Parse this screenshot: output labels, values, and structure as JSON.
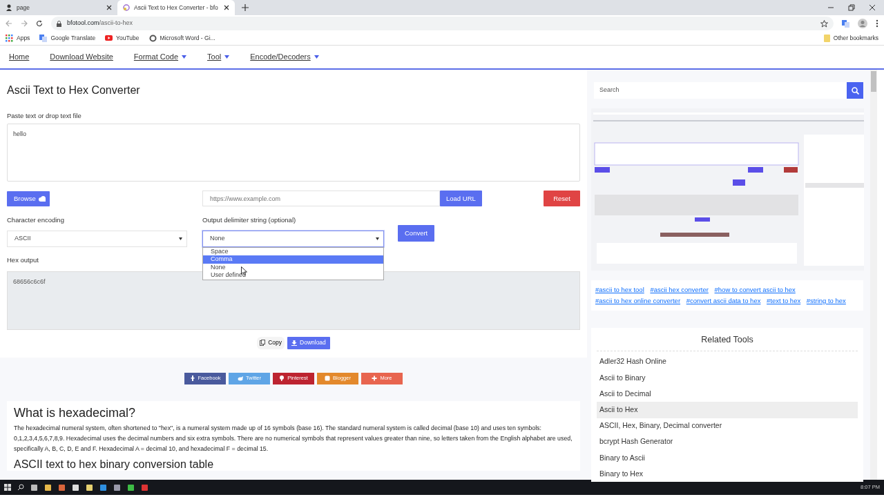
{
  "browser": {
    "tabs": [
      {
        "title": "page",
        "selected": false
      },
      {
        "title": "Ascii Text to Hex Converter - bfo",
        "selected": true
      }
    ],
    "url_host": "bfotool.com",
    "url_path": "/ascii-to-hex",
    "bookmarks": [
      "Apps",
      "Google Translate",
      "YouTube",
      "Microsoft Word - Gi..."
    ],
    "other_bookmarks": "Other bookmarks"
  },
  "nav": {
    "items": [
      {
        "label": "Home",
        "dropdown": false
      },
      {
        "label": "Download Website",
        "dropdown": false
      },
      {
        "label": "Format Code",
        "dropdown": true
      },
      {
        "label": "Tool",
        "dropdown": true
      },
      {
        "label": "Encode/Decoders",
        "dropdown": true
      }
    ]
  },
  "converter": {
    "title": "Ascii Text to Hex Converter",
    "input_label": "Paste text or drop text file",
    "input_value": "hello",
    "browse": "Browse",
    "url_placeholder": "https://www.example.com",
    "load_url": "Load URL",
    "reset": "Reset",
    "encoding_label": "Character encoding",
    "encoding_value": "ASCII",
    "delimiter_label": "Output delimiter string (optional)",
    "delimiter_value": "None",
    "delimiter_expanded": true,
    "delimiter_options": [
      {
        "label": "Space",
        "selected": false
      },
      {
        "label": "Comma",
        "selected": true
      },
      {
        "label": "None",
        "selected": false
      },
      {
        "label": "User defined",
        "selected": false
      }
    ],
    "convert": "Convert",
    "output_label": "Hex output",
    "output_value": "68656c6c6f",
    "copy": "Copy",
    "download": "Download"
  },
  "share": [
    {
      "kind": "facebook",
      "label": "Facebook",
      "color": "#4a5a9d"
    },
    {
      "kind": "twitter",
      "label": "Twitter",
      "color": "#5fa5e6"
    },
    {
      "kind": "pinterest",
      "label": "Pinterest",
      "color": "#bd2430"
    },
    {
      "kind": "blogger",
      "label": "Blogger",
      "color": "#e3892c"
    },
    {
      "kind": "more",
      "label": "More",
      "color": "#e8654f"
    }
  ],
  "article": {
    "heading": "What is hexadecimal?",
    "paragraph": "The hexadecimal numeral system, often shortened to \"hex\", is a numeral system made up of 16 symbols (base 16). The standard numeral system is called decimal (base 10) and uses ten symbols: 0,1,2,3,4,5,6,7,8,9. Hexadecimal uses the decimal numbers and six extra symbols. There are no numerical symbols that represent values greater than nine, so letters taken from the English alphabet are used, specifically A, B, C, D, E and F. Hexadecimal A = decimal 10, and hexadecimal F = decimal 15.",
    "heading2": "ASCII text to hex binary conversion table"
  },
  "sidebar": {
    "search_placeholder": "Search",
    "tags": [
      "#ascii to hex tool",
      "#ascii hex converter",
      "#how to convert ascii to hex",
      "#ascii to hex online converter",
      "#convert ascii data to hex",
      "#text to hex",
      "#string to hex"
    ],
    "related_title": "Related Tools",
    "related": [
      {
        "label": "Adler32 Hash Online",
        "selected": false
      },
      {
        "label": "Ascii to Binary",
        "selected": false
      },
      {
        "label": "Ascii to Decimal",
        "selected": false
      },
      {
        "label": "Ascii to Hex",
        "selected": true
      },
      {
        "label": "ASCII, Hex, Binary, Decimal converter",
        "selected": false
      },
      {
        "label": "bcrypt Hash Generator",
        "selected": false
      },
      {
        "label": "Binary to Ascii",
        "selected": false
      },
      {
        "label": "Binary to Hex",
        "selected": false
      }
    ]
  },
  "taskbar": {
    "time": "8:07 PM"
  }
}
